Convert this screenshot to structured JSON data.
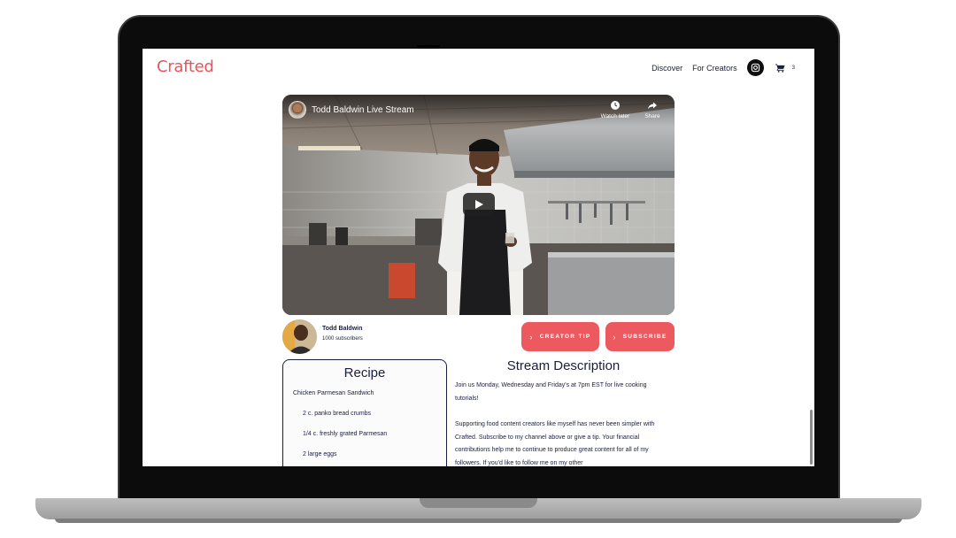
{
  "header": {
    "logo": "Crafted",
    "nav": [
      "Discover",
      "For Creators"
    ],
    "cart_count": "3"
  },
  "video": {
    "title": "Todd Baldwin Live Stream",
    "watch_later": "Watch later",
    "share": "Share"
  },
  "creator": {
    "name": "Todd Baldwin",
    "subscribers": "1000 subscribers"
  },
  "buttons": {
    "tip": "CREATOR TIP",
    "subscribe": "SUBSCRIBE"
  },
  "recipe": {
    "title": "Recipe",
    "dish": "Chicken Parmesan Sandwich",
    "ingredients": [
      "2 c. panko bread crumbs",
      "1/4 c. freshly grated Parmesan",
      "2 large eggs"
    ]
  },
  "description": {
    "title": "Stream Description",
    "paragraphs": [
      "Join us Monday, Wednesday and Friday's at 7pm EST for live cooking tutorials!",
      "Supporting food content creators like myself has never been simpler with Crafted. Subscribe to my channel above or give a tip. Your financial contributions help me to continue to produce great content for all of my followers. If you'd like to follow me on my other"
    ]
  },
  "colors": {
    "brand": "#e5565b",
    "button": "#ec5a5f",
    "text": "#1a1f3d"
  },
  "icons": [
    "instagram-icon",
    "cart-icon",
    "clock-icon",
    "share-icon",
    "play-icon",
    "chevron-right-icon"
  ]
}
